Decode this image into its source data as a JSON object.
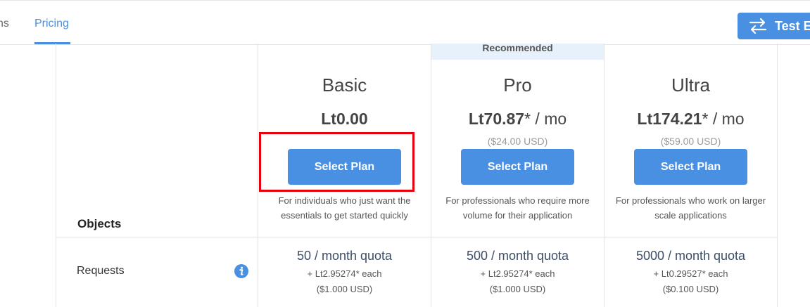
{
  "nav": {
    "prev_tab": "ns",
    "active_tab": "Pricing",
    "test_button": "Test E"
  },
  "recommended_label": "Recommended",
  "plans": [
    {
      "name": "Basic",
      "price": "Lt0.00",
      "price_suffix": "",
      "usd": "",
      "button": "Select Plan",
      "description": "For individuals who just want the essentials to get started quickly"
    },
    {
      "name": "Pro",
      "price": "Lt70.87",
      "price_suffix": "* / mo",
      "usd": "($24.00 USD)",
      "button": "Select Plan",
      "description": "For professionals who require more volume for their application"
    },
    {
      "name": "Ultra",
      "price": "Lt174.21",
      "price_suffix": "* / mo",
      "usd": "($59.00 USD)",
      "button": "Select Plan",
      "description": "For professionals who work on larger scale applications"
    }
  ],
  "rows": {
    "objects_label": "Objects",
    "requests_label": "Requests",
    "requests": [
      {
        "quota": "50 / month quota",
        "each": "+ Lt2.95274* each",
        "usd": "($1.000 USD)"
      },
      {
        "quota": "500 / month quota",
        "each": "+ Lt2.95274* each",
        "usd": "($1.000 USD)"
      },
      {
        "quota": "5000 / month quota",
        "each": "+ Lt0.29527* each",
        "usd": "($0.100 USD)"
      }
    ]
  },
  "colors": {
    "accent": "#4a90e2",
    "highlight": "#e8000b",
    "recommended_bg": "#e7f1fb"
  }
}
